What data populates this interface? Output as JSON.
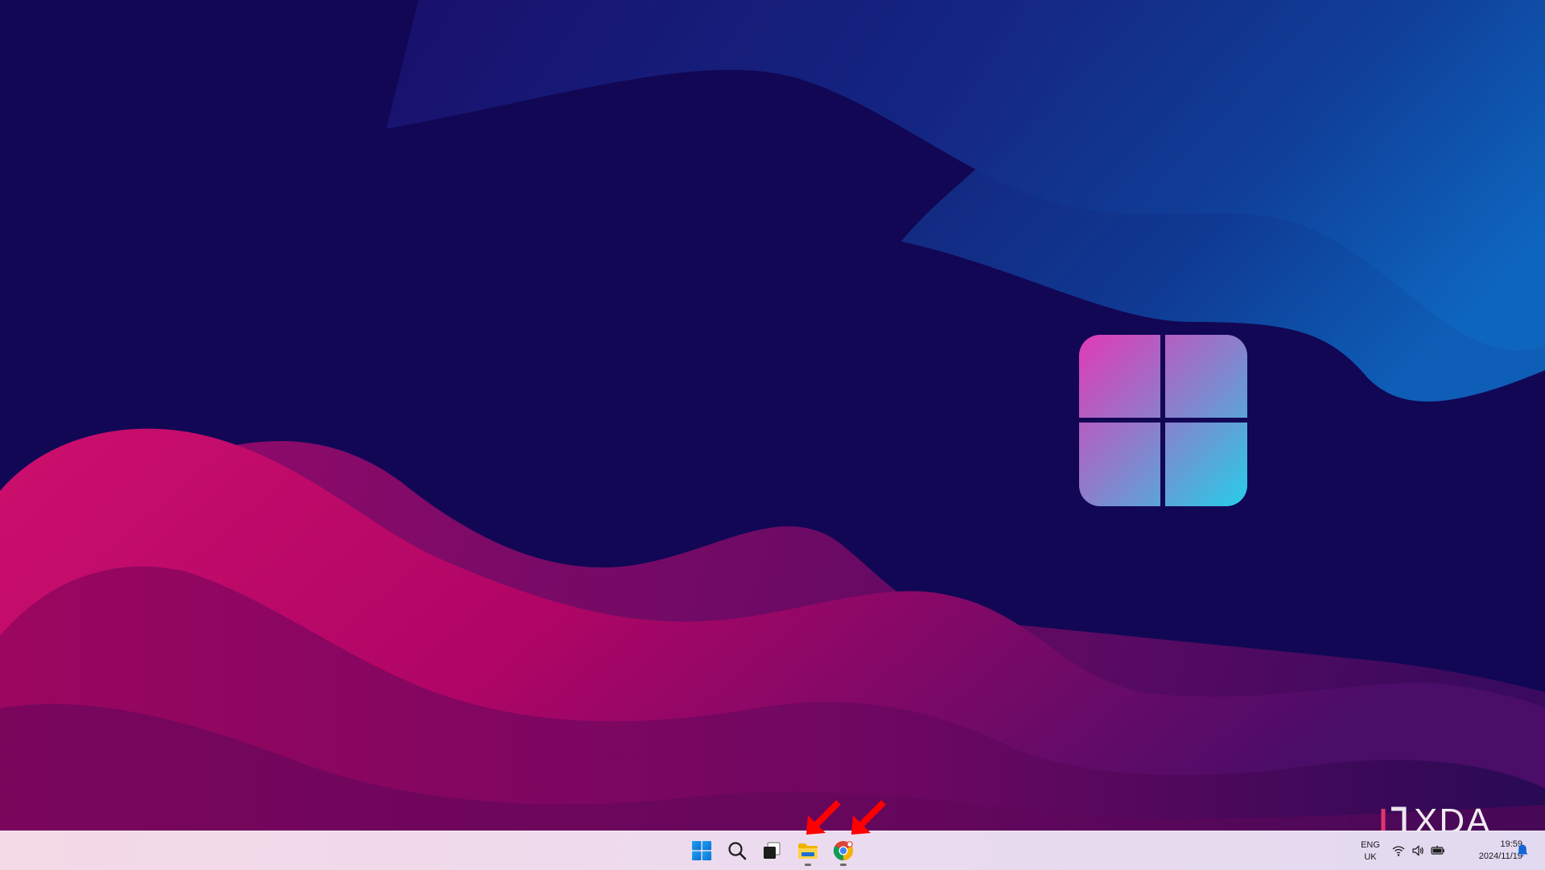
{
  "desktop": {
    "wallpaper": "windows-11-wave-wallpaper",
    "colors": {
      "background": "#120755",
      "blue_wave": "#1062b8",
      "pink_wave": "#c8106e",
      "logo_gradient_start": "#e03bb5",
      "logo_gradient_end": "#2bcbe6"
    }
  },
  "watermark": {
    "text": "XDA"
  },
  "taskbar": {
    "apps": [
      {
        "name": "Start",
        "icon": "windows-start-icon",
        "running": false
      },
      {
        "name": "Search",
        "icon": "search-icon",
        "running": false
      },
      {
        "name": "Task View",
        "icon": "task-view-icon",
        "running": false
      },
      {
        "name": "File Explorer",
        "icon": "folder-icon",
        "running": true,
        "highlighted": true
      },
      {
        "name": "Google Chrome",
        "icon": "chrome-icon",
        "running": true,
        "highlighted": true
      }
    ],
    "annotation_color": "#ff0000"
  },
  "tray": {
    "language_line1": "ENG",
    "language_line2": "UK",
    "icons": [
      "wifi-icon",
      "volume-icon",
      "battery-icon"
    ],
    "time": "19:59",
    "date": "2024/11/19",
    "notification_icon": "bell-icon"
  }
}
